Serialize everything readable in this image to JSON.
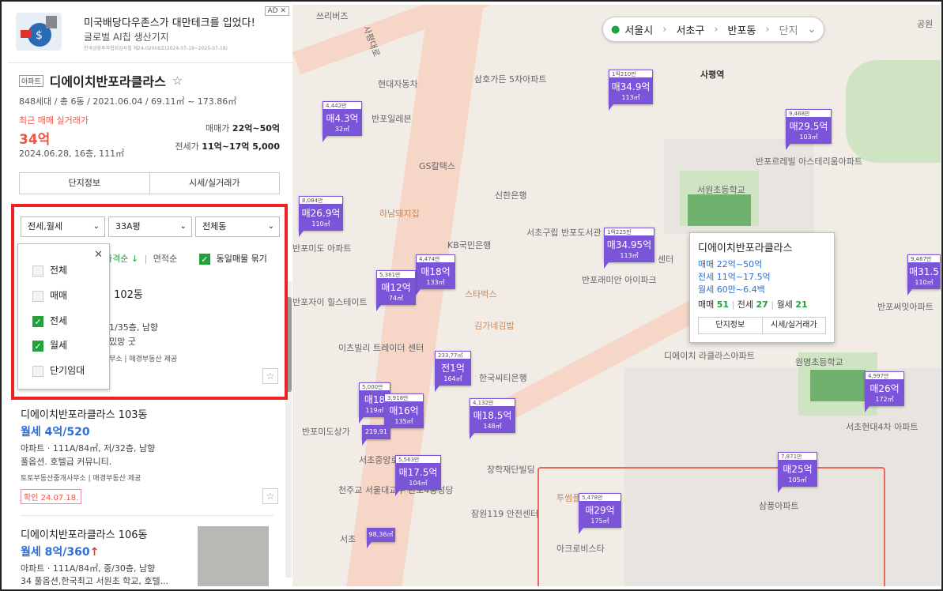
{
  "ad": {
    "badge": "AD ✕",
    "line1": "미국배당다우존스가 대만테크를 입었다!",
    "line2": "글로벌 AI칩 생산기지",
    "line3": "한국금융투자협회심사필 제24-02006호(2024-07-19~2025-07-18)"
  },
  "complex": {
    "tag": "아파트",
    "name": "디에이치반포라클라스",
    "star": "☆",
    "meta": "848세대 / 총 6동 / 2021.06.04 / 69.11㎡ ~ 173.86㎡",
    "recent_label": "최근 매매 실거래가",
    "recent_price": "34억",
    "recent_date": "2024.06.28, 16층, 111㎡",
    "sale_label": "매매가",
    "sale_range": "22억~50억",
    "jeonse_label": "전세가",
    "jeonse_range": "11억~17억 5,000",
    "btn_info": "단지정보",
    "btn_price": "시세/실거래가"
  },
  "filters": {
    "trade": "전세,월세",
    "size": "33A평",
    "dong": "전체동",
    "chevron": "⌄"
  },
  "sort": {
    "price": "가격순 ↓",
    "area": "면적순",
    "same": "동일매물 묶기"
  },
  "dropdown": {
    "close": "✕",
    "items": [
      {
        "label": "전체",
        "checked": false
      },
      {
        "label": "매매",
        "checked": false
      },
      {
        "label": "전세",
        "checked": true
      },
      {
        "label": "월세",
        "checked": true
      },
      {
        "label": "단기임대",
        "checked": false
      }
    ]
  },
  "listings": [
    {
      "title": "스 102동",
      "meta": "1/35층, 남향",
      "meta2": "밌망 굿",
      "src": "무소 | 매경부동산 제공"
    },
    {
      "title": "디에이치반포라클라스 103동",
      "price": "월세 4억/520",
      "meta": "아파트 · 111A/84㎡, 저/32층, 남향",
      "meta2": "풀옵션. 호텔급 커뮤니티.",
      "src": "토토부동산중개사무소 | 매경부동산 제공",
      "confirm": "확인 24.07.18."
    },
    {
      "title": "디에이치반포라클라스 106동",
      "price": "월세 8억/360",
      "up": "↑",
      "meta": "아파트 · 111A/84㎡, 중/30층, 남향",
      "meta2": "34 풀옵션,한국최고 서원초 학교, 호텔..."
    }
  ],
  "breadcrumb": {
    "city": "서울시",
    "gu": "서초구",
    "dong": "반포동",
    "type": "단지",
    "sep": "›",
    "pin": "●"
  },
  "markers": [
    {
      "count": "4,442만",
      "price": "매4.3억",
      "area": "32㎡"
    },
    {
      "count": "1억210만",
      "price": "매34.9억",
      "area": "113㎡"
    },
    {
      "count": "9,468만",
      "price": "매29.5억",
      "area": "103㎡"
    },
    {
      "count": "8,084만",
      "price": "매26.9억",
      "area": "110㎡"
    },
    {
      "count": "1억225만",
      "price": "매34.95억",
      "area": "113㎡"
    },
    {
      "count": "4,474만",
      "price": "매18억",
      "area": "133㎡"
    },
    {
      "count": "5,361만",
      "price": "매12억",
      "area": "74㎡"
    },
    {
      "count": "233,77㎡",
      "price": "전1억",
      "area": "164㎡"
    },
    {
      "count": "5,000만",
      "price": "매18",
      "area": "119㎡"
    },
    {
      "count": "3,918만",
      "price": "매16억",
      "area": "135㎡"
    },
    {
      "count": "4,132만",
      "price": "매18.5억",
      "area": "148㎡"
    },
    {
      "count": "5,563만",
      "price": "매17.5억",
      "area": "104㎡"
    },
    {
      "count": "7,871만",
      "price": "매25억",
      "area": "105㎡"
    },
    {
      "count": "5,478만",
      "price": "매29억",
      "area": "175㎡"
    },
    {
      "count": "4,997만",
      "price": "매26억",
      "area": "172㎡"
    },
    {
      "count": "9,467만",
      "price": "매31.5",
      "area": "110㎡"
    }
  ],
  "small_tags": {
    "t1": "219,91",
    "t2": "98,36㎡"
  },
  "popup": {
    "title": "디에이치반포라클라스",
    "sale": "매매 22억~50억",
    "jeonse": "전세 11억~17.5억",
    "monthly": "월세 60만~6.4백",
    "c_sale": "매매",
    "n_sale": "51",
    "c_jeonse": "전세",
    "n_jeonse": "27",
    "c_month": "월세",
    "n_month": "21",
    "btn1": "단지정보",
    "btn2": "시세/실거래가"
  },
  "pois": {
    "p1": "쓰리버즈",
    "p2": "사평대로",
    "p3": "사평역",
    "p4": "현대자동차",
    "p5": "삼호가든 5차아파트",
    "p6": "반포일레븐",
    "p7": "GS칼텍스",
    "p8": "신한은행",
    "p9": "하남돼지집",
    "p10": "KB국민은행",
    "p11": "서초구립 반포도서관",
    "p12": "서원초등학교",
    "p13": "반포르레빌 아스테리움아파트",
    "p14": "반포미도 아파트",
    "p15": "반포자이 힐스테이트",
    "p16": "스타벅스",
    "p17": "김가네김밥",
    "p18": "이츠빌리 트레이더 센터",
    "p19": "한국씨티은행",
    "p20": "반포래미안 아이파크",
    "p21": "디에이치 라클라스아파트",
    "p22": "원명초등학교",
    "p23": "서초현대4차 아파트",
    "p24": "반포미도상가",
    "p25": "서초중앙로",
    "p26": "장학재단빌딩",
    "p27": "천주교 서울대교구 반포4동성당",
    "p28": "잠원119 안전센터",
    "p29": "투썸플",
    "p30": "아크로비스타",
    "p31": "삼풍아파트",
    "p32": "서초",
    "p33": "공원",
    "p34": "반포써밋아파트",
    "p35": "센터"
  }
}
